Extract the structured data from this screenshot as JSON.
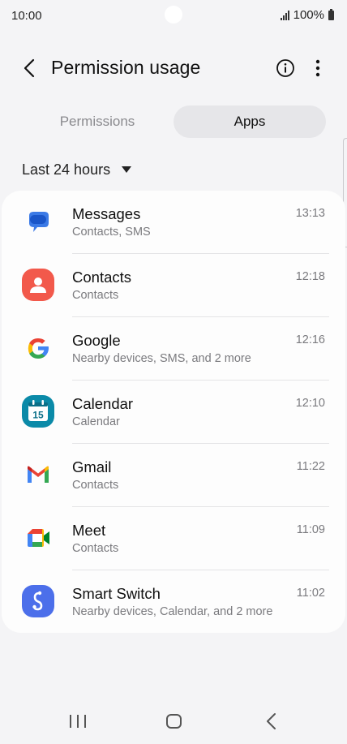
{
  "status": {
    "time": "10:00",
    "battery": "100%"
  },
  "header": {
    "title": "Permission usage"
  },
  "tabs": [
    {
      "label": "Permissions",
      "selected": false
    },
    {
      "label": "Apps",
      "selected": true
    }
  ],
  "filter": {
    "label": "Last 24 hours"
  },
  "apps": [
    {
      "name": "Messages",
      "permissions": "Contacts, SMS",
      "time": "13:13",
      "icon": "messages-icon"
    },
    {
      "name": "Contacts",
      "permissions": "Contacts",
      "time": "12:18",
      "icon": "contacts-icon"
    },
    {
      "name": "Google",
      "permissions": "Nearby devices, SMS, and 2 more",
      "time": "12:16",
      "icon": "google-icon"
    },
    {
      "name": "Calendar",
      "permissions": "Calendar",
      "time": "12:10",
      "icon": "calendar-icon",
      "icon_text": "15"
    },
    {
      "name": "Gmail",
      "permissions": "Contacts",
      "time": "11:22",
      "icon": "gmail-icon"
    },
    {
      "name": "Meet",
      "permissions": "Contacts",
      "time": "11:09",
      "icon": "meet-icon"
    },
    {
      "name": "Smart Switch",
      "permissions": "Nearby devices, Calendar, and 2 more",
      "time": "11:02",
      "icon": "smart-switch-icon"
    }
  ],
  "colors": {
    "background": "#f4f4f6",
    "card": "#fdfdfd",
    "selected_tab": "#e6e6e9",
    "secondary_text": "#7a7a7e"
  }
}
